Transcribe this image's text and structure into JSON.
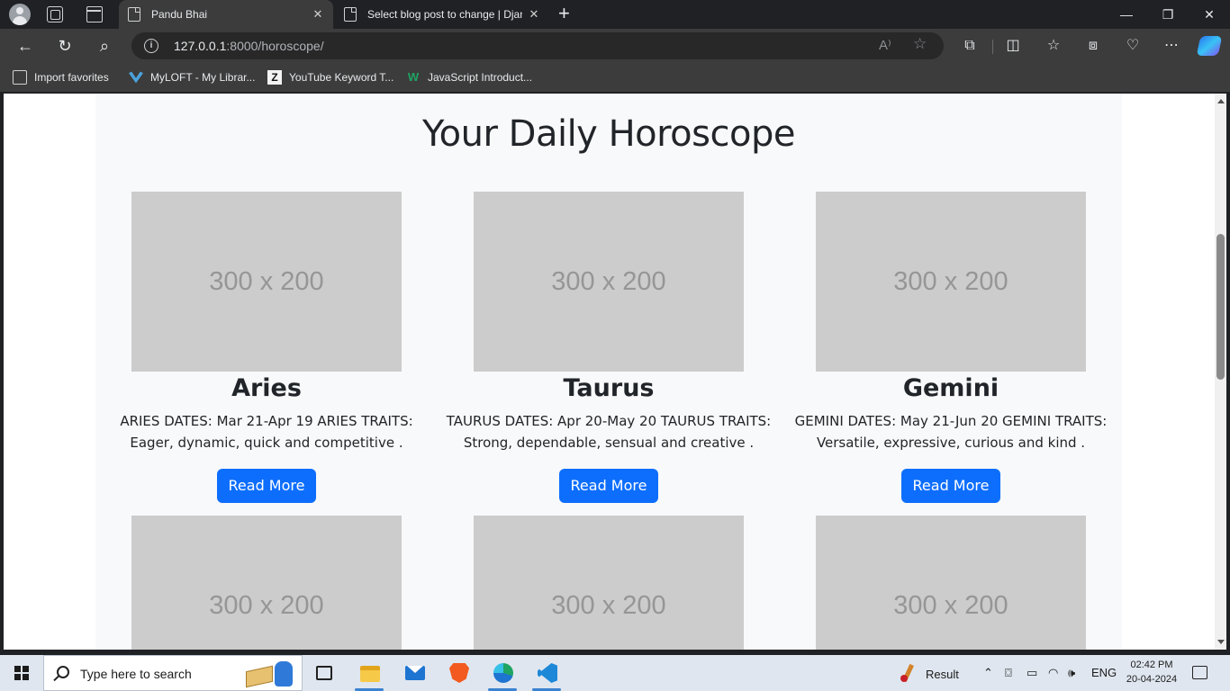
{
  "browser": {
    "tabs": [
      {
        "title": "Pandu Bhai",
        "active": true
      },
      {
        "title": "Select blog post to change | Djan",
        "active": false
      }
    ],
    "new_tab_glyph": "+",
    "window_controls": {
      "minimize": "—",
      "restore": "❐",
      "close": "✕"
    },
    "url": {
      "host": "127.0.0.1",
      "rest": ":8000/horoscope/"
    },
    "nav_glyphs": {
      "back": "←",
      "refresh": "↻",
      "search": "⌕"
    },
    "favorites": [
      {
        "label": "Import favorites",
        "icon": "import-favorites-icon"
      },
      {
        "label": "MyLOFT - My Librar...",
        "icon": "myloft-icon"
      },
      {
        "label": "YouTube Keyword T...",
        "icon": "zz-icon"
      },
      {
        "label": "JavaScript Introduct...",
        "icon": "js-icon"
      }
    ]
  },
  "page": {
    "title": "Your Daily Horoscope",
    "placeholder_text": "300 x 200",
    "cards": [
      {
        "name": "Aries",
        "text": "ARIES DATES: Mar 21-Apr 19 ARIES TRAITS: Eager, dynamic, quick and competitive .",
        "button": "Read More"
      },
      {
        "name": "Taurus",
        "text": "TAURUS DATES: Apr 20-May 20 TAURUS TRAITS: Strong, dependable, sensual and creative .",
        "button": "Read More"
      },
      {
        "name": "Gemini",
        "text": "GEMINI DATES: May 21-Jun 20 GEMINI TRAITS: Versatile, expressive, curious and kind .",
        "button": "Read More"
      }
    ]
  },
  "taskbar": {
    "search_placeholder": "Type here to search",
    "result_label": "Result",
    "language": "ENG",
    "time": "02:42 PM",
    "date": "20-04-2024",
    "apps": [
      "task-view",
      "file-explorer",
      "mail",
      "brave",
      "edge",
      "vscode"
    ]
  },
  "colors": {
    "accent": "#0d6efd",
    "placeholder_bg": "#cccccc",
    "container_bg": "#f8f9fa"
  }
}
